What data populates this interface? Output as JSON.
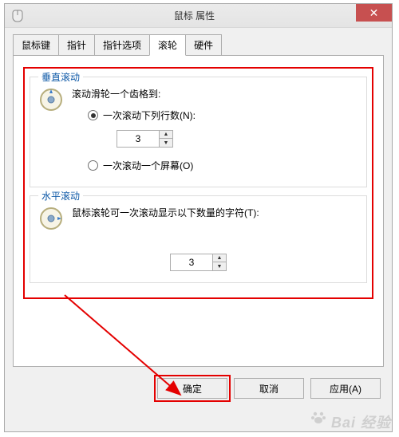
{
  "window": {
    "title": "鼠标 属性"
  },
  "tabs": {
    "items": [
      {
        "label": "鼠标键"
      },
      {
        "label": "指针"
      },
      {
        "label": "指针选项"
      },
      {
        "label": "滚轮"
      },
      {
        "label": "硬件"
      }
    ],
    "active_index": 3
  },
  "vertical": {
    "group_title": "垂直滚动",
    "prompt": "滚动滑轮一个齿格到:",
    "opt_lines": "一次滚动下列行数(N):",
    "opt_screen": "一次滚动一个屏幕(O)",
    "value": "3",
    "selected": "lines"
  },
  "horizontal": {
    "group_title": "水平滚动",
    "prompt": "鼠标滚轮可一次滚动显示以下数量的字符(T):",
    "value": "3"
  },
  "buttons": {
    "ok": "确定",
    "cancel": "取消",
    "apply": "应用(A)"
  },
  "icons": {
    "close": "✕",
    "up": "▲",
    "down": "▼"
  },
  "watermark": "Bai 经验"
}
